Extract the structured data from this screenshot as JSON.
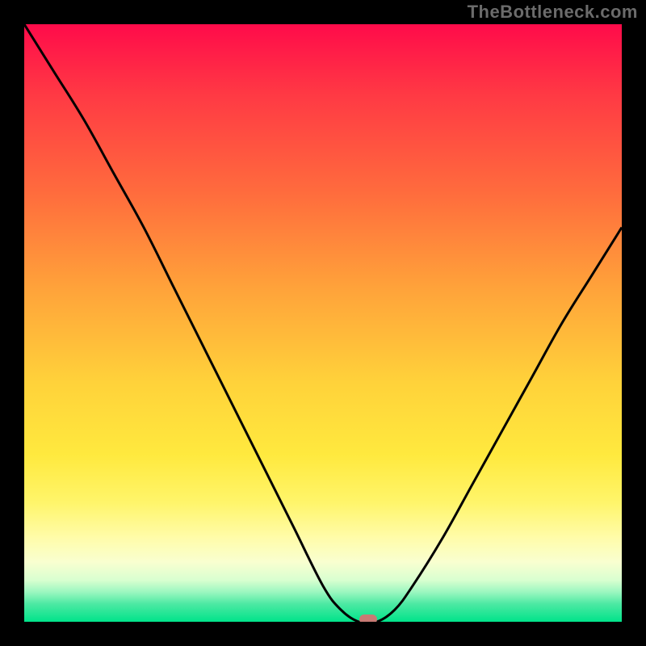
{
  "watermark": "TheBottleneck.com",
  "colors": {
    "frame_bg": "#000000",
    "curve_stroke": "#000000",
    "marker_fill": "#c77a74",
    "watermark_text": "#6b6b6b"
  },
  "chart_data": {
    "type": "line",
    "title": "",
    "xlabel": "",
    "ylabel": "",
    "x": [
      0.0,
      0.05,
      0.1,
      0.15,
      0.2,
      0.25,
      0.3,
      0.35,
      0.4,
      0.45,
      0.5,
      0.53,
      0.56,
      0.59,
      0.62,
      0.65,
      0.7,
      0.75,
      0.8,
      0.85,
      0.9,
      0.95,
      1.0
    ],
    "values": [
      1.0,
      0.92,
      0.84,
      0.75,
      0.66,
      0.56,
      0.46,
      0.36,
      0.26,
      0.16,
      0.06,
      0.02,
      0.0,
      0.0,
      0.02,
      0.06,
      0.14,
      0.23,
      0.32,
      0.41,
      0.5,
      0.58,
      0.66
    ],
    "xlim": [
      0,
      1
    ],
    "ylim": [
      0,
      1
    ],
    "marker": {
      "x": 0.575,
      "y": 0.0
    }
  }
}
